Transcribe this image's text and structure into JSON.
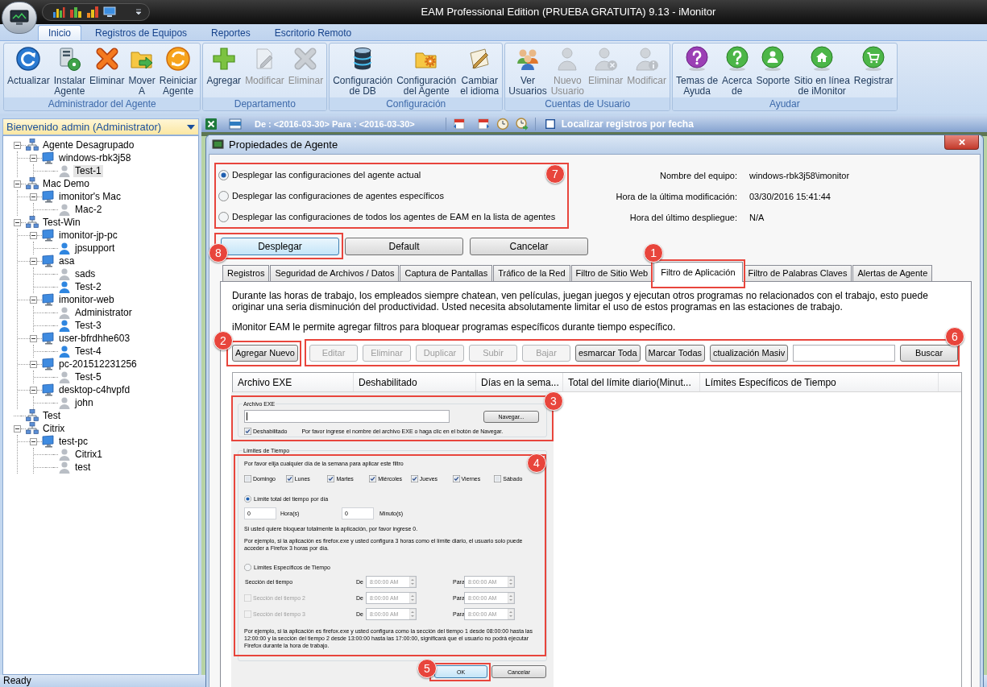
{
  "window": {
    "title": "EAM Professional Edition (PRUEBA GRATUITA) 9.13 - iMonitor"
  },
  "ribbon": {
    "tabs": [
      {
        "label": "Inicio",
        "selected": true
      },
      {
        "label": "Registros de Equipos",
        "selected": false
      },
      {
        "label": "Reportes",
        "selected": false
      },
      {
        "label": "Escritorio Remoto",
        "selected": false
      }
    ],
    "groups": [
      {
        "label": "Administrador del Agente",
        "buttons": [
          {
            "label": "Actualizar",
            "disabled": false
          },
          {
            "label": "Instalar\nAgente",
            "disabled": false
          },
          {
            "label": "Eliminar",
            "disabled": false
          },
          {
            "label": "Mover\nA",
            "disabled": false
          },
          {
            "label": "Reiniciar\nAgente",
            "disabled": false
          }
        ]
      },
      {
        "label": "Departamento",
        "buttons": [
          {
            "label": "Agregar",
            "disabled": false
          },
          {
            "label": "Modificar",
            "disabled": true
          },
          {
            "label": "Eliminar",
            "disabled": true
          }
        ]
      },
      {
        "label": "Configuración",
        "buttons": [
          {
            "label": "Configuración\nde DB",
            "disabled": false
          },
          {
            "label": "Configuración\ndel Agente",
            "disabled": false
          },
          {
            "label": "Cambiar\nel idioma",
            "disabled": false
          }
        ]
      },
      {
        "label": "Cuentas de Usuario",
        "buttons": [
          {
            "label": "Ver\nUsuarios",
            "disabled": false
          },
          {
            "label": "Nuevo\nUsuario",
            "disabled": true
          },
          {
            "label": "Eliminar",
            "disabled": true
          },
          {
            "label": "Modificar",
            "disabled": true
          }
        ]
      },
      {
        "label": "Ayudar",
        "buttons": [
          {
            "label": "Temas de\nAyuda",
            "disabled": false
          },
          {
            "label": "Acerca\nde",
            "disabled": false
          },
          {
            "label": "Soporte",
            "disabled": false
          },
          {
            "label": "Sitio en línea\nde iMonitor",
            "disabled": false
          },
          {
            "label": "Registrar",
            "disabled": false
          }
        ]
      }
    ]
  },
  "agent_pane": {
    "header": "Bienvenido admin (Administrator)",
    "tree": [
      {
        "label": "Agente Desagrupado",
        "kind": "group",
        "selected": false,
        "expanded": true,
        "children": [
          {
            "label": "windows-rbk3j58",
            "kind": "computer",
            "selected": false,
            "expanded": true,
            "children": [
              {
                "label": "Test-1",
                "kind": "user",
                "online": false,
                "selected": true
              }
            ]
          }
        ]
      },
      {
        "label": "Mac Demo",
        "kind": "group",
        "selected": false,
        "expanded": true,
        "children": [
          {
            "label": "imonitor's Mac",
            "kind": "computer",
            "selected": false,
            "expanded": true,
            "children": [
              {
                "label": "Mac-2",
                "kind": "user",
                "online": false,
                "selected": false
              }
            ]
          }
        ]
      },
      {
        "label": "Test-Win",
        "kind": "group",
        "selected": false,
        "expanded": true,
        "children": [
          {
            "label": "imonitor-jp-pc",
            "kind": "computer",
            "selected": false,
            "expanded": true,
            "children": [
              {
                "label": "jpsupport",
                "kind": "user",
                "online": true,
                "selected": false
              }
            ]
          },
          {
            "label": "asa",
            "kind": "computer",
            "selected": false,
            "expanded": true,
            "children": [
              {
                "label": "sads",
                "kind": "user",
                "online": false,
                "selected": false
              },
              {
                "label": "Test-2",
                "kind": "user",
                "online": true,
                "selected": false
              }
            ]
          },
          {
            "label": "imonitor-web",
            "kind": "computer",
            "selected": false,
            "expanded": true,
            "children": [
              {
                "label": "Administrator",
                "kind": "user",
                "online": false,
                "selected": false
              },
              {
                "label": "Test-3",
                "kind": "user",
                "online": true,
                "selected": false
              }
            ]
          },
          {
            "label": "user-bfrdhhe603",
            "kind": "computer",
            "selected": false,
            "expanded": true,
            "children": [
              {
                "label": "Test-4",
                "kind": "user",
                "online": true,
                "selected": false
              }
            ]
          },
          {
            "label": "pc-201512231256",
            "kind": "computer",
            "selected": false,
            "expanded": true,
            "children": [
              {
                "label": "Test-5",
                "kind": "user",
                "online": false,
                "selected": false
              }
            ]
          },
          {
            "label": "desktop-c4hvpfd",
            "kind": "computer",
            "selected": false,
            "expanded": true,
            "children": [
              {
                "label": "john",
                "kind": "user",
                "online": false,
                "selected": false
              }
            ]
          }
        ]
      },
      {
        "label": "Test",
        "kind": "group",
        "selected": false
      },
      {
        "label": "Citrix",
        "kind": "group",
        "selected": false,
        "expanded": true,
        "children": [
          {
            "label": "test-pc",
            "kind": "computer",
            "selected": false,
            "expanded": true,
            "children": [
              {
                "label": "Citrix1",
                "kind": "user",
                "online": false,
                "selected": false
              },
              {
                "label": "test",
                "kind": "user",
                "online": false,
                "selected": false
              }
            ]
          }
        ]
      }
    ]
  },
  "date_toolbar": {
    "range": "De : <2016-03-30> Para : <2016-03-30>",
    "locate_by_date": {
      "label": "Localizar registros por fecha",
      "checked": false
    }
  },
  "dialog": {
    "title": "Propiedades de Agente",
    "deploy_scope": {
      "marker": "7",
      "options": [
        {
          "label": "Desplegar las configuraciones del agente actual",
          "selected": true
        },
        {
          "label": "Desplegar las configuraciones de agentes específicos",
          "selected": false
        },
        {
          "label": "Desplegar las configuraciones de todos los agentes de EAM en la lista de agentes",
          "selected": false
        }
      ]
    },
    "info": [
      {
        "label": "Nombre del equipo:",
        "value": "windows-rbk3j58\\imonitor"
      },
      {
        "label": "Hora de la última modificación:",
        "value": "03/30/2016 15:41:44"
      },
      {
        "label": "Hora del último despliegue:",
        "value": "N/A"
      }
    ],
    "buttons": [
      {
        "label": "Desplegar",
        "focused": true,
        "marker": "8"
      },
      {
        "label": "Default",
        "focused": false
      },
      {
        "label": "Cancelar",
        "focused": false
      }
    ],
    "tabs": [
      {
        "label": "Registros",
        "selected": false
      },
      {
        "label": "Seguridad de Archivos / Datos",
        "selected": false
      },
      {
        "label": "Captura de Pantallas",
        "selected": false
      },
      {
        "label": "Tráfico de la Red",
        "selected": false
      },
      {
        "label": "Filtro de Sitio Web",
        "selected": false
      },
      {
        "label": "Filtro de Aplicación",
        "selected": true,
        "marker": "1"
      },
      {
        "label": "Filtro de Palabras Claves",
        "selected": false
      },
      {
        "label": "Alertas de Agente",
        "selected": false
      }
    ],
    "description": [
      "Durante las horas de trabajo, los empleados siempre chatean, ven películas, juegan juegos y ejecutan otros programas no relacionados con el trabajo, esto puede originar una seria disminución del productividad. Usted necesita absolutamente limitar el uso de estos programas en las estaciones de trabajo.",
      "iMonitor EAM le permite agregar filtros para bloquear programas específicos durante tiempo específico."
    ],
    "add_button": {
      "label": "Agregar Nuevo",
      "marker": "2"
    },
    "toolbar": {
      "marker": "6",
      "buttons": [
        {
          "label": "Editar",
          "disabled": true
        },
        {
          "label": "Eliminar",
          "disabled": true
        },
        {
          "label": "Duplicar",
          "disabled": true
        },
        {
          "label": "Subir",
          "disabled": true
        },
        {
          "label": "Bajar",
          "disabled": true
        },
        {
          "label": "esmarcar Toda",
          "disabled": false
        },
        {
          "label": "Marcar Todas",
          "disabled": false
        },
        {
          "label": "ctualización Masiv",
          "disabled": false
        }
      ],
      "search_button": "Buscar"
    },
    "table": {
      "columns": [
        "Archivo EXE",
        "Deshabilitado",
        "Días en la sema...",
        "Total del límite diario(Minut...",
        "Límites Específicos de Tiempo"
      ]
    },
    "filter_form": {
      "exe_section": {
        "marker": "3",
        "legend": "Archivo EXE",
        "field_focused": true,
        "browse_button": "Navegar...",
        "disabled_checkbox": {
          "label": "Deshabilitado",
          "checked": true
        },
        "hint": "Por favor ingrese el nombre del archivo EXE o haga clic en el botón de Navegar."
      },
      "limits_legend": "Límites de Tiempo",
      "limits": {
        "marker": "4",
        "days_prompt": "Por favor elija cualquier día de la semana para aplicar este filtro",
        "days": [
          {
            "label": "Domingo",
            "checked": false
          },
          {
            "label": "Lunes",
            "checked": true
          },
          {
            "label": "Martes",
            "checked": true
          },
          {
            "label": "Miércoles",
            "checked": true
          },
          {
            "label": "Jueves",
            "checked": true
          },
          {
            "label": "Viernes",
            "checked": true
          },
          {
            "label": "Sábado",
            "checked": false
          }
        ],
        "daily_total": {
          "label": "Límite total del tiempo por día",
          "selected": true,
          "hours": {
            "value": "0",
            "unit": "Hora(s)"
          },
          "minutes": {
            "value": "0",
            "unit": "Minuto(s)"
          },
          "note": "Si usted quiere bloquear totalmente la aplicación, por favor ingrese 0.",
          "example": "Por ejemplo, si la aplicación es firefox.exe y usted configura 3 horas como el límite diario, el usuario solo puede acceder a Firefox 3 horas por día."
        },
        "specific": {
          "label": "Límites Específicos de Tiempo",
          "selected": false,
          "disabled": true,
          "sections": [
            {
              "kind": "plain",
              "label": "Sección del tiempo",
              "from_label": "De",
              "from": "8:00:00 AM",
              "to_label": "Para",
              "to": "8:00:00 AM"
            },
            {
              "kind": "checkbox",
              "label": "Sección del tiempo 2",
              "checked": false,
              "from_label": "De",
              "from": "8:00:00 AM",
              "to_label": "Para",
              "to": "8:00:00 AM"
            },
            {
              "kind": "checkbox",
              "label": "Sección del tiempo 3",
              "checked": false,
              "from_label": "De",
              "from": "8:00:00 AM",
              "to_label": "Para",
              "to": "8:00:00 AM"
            }
          ],
          "example": "Por ejemplo, si la aplicación es firefox.exe y usted configura como la sección del tiempo 1 desde 08:00:00 hasta las 12:00:00 y la sección del tiempo 2 desde 13:00:00 hasta las 17:00:00, significará que el usuario no podrá ejecutar Firefox durante la hora de trabajo."
        }
      },
      "buttons": [
        {
          "label": "OK",
          "focused": true,
          "marker": "5"
        },
        {
          "label": "Cancelar",
          "focused": false
        }
      ]
    }
  },
  "status_bar": {
    "text": "Ready"
  }
}
